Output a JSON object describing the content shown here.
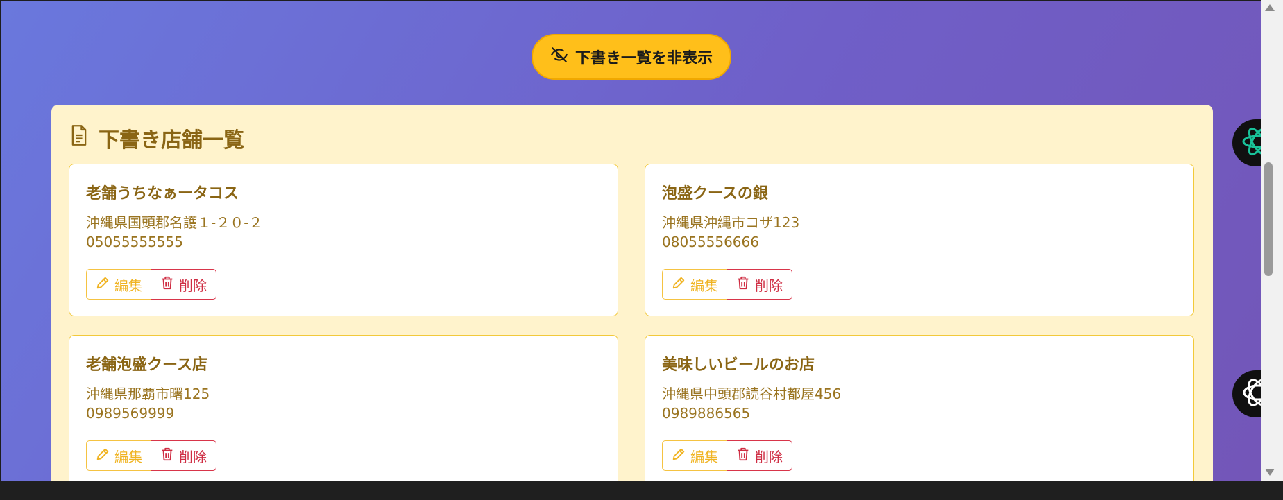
{
  "toggle_button": {
    "label": "下書き一覧を非表示",
    "icon": "eye-slash-icon"
  },
  "panel": {
    "title": "下書き店舗一覧",
    "icon": "document-icon",
    "cards": [
      {
        "name": "老舗うちなぁータコス",
        "address": "沖縄県国頭郡名護１-２０-２",
        "phone": "05055555555",
        "edit_label": "編集",
        "delete_label": "削除"
      },
      {
        "name": "泡盛クースの銀",
        "address": "沖縄県沖縄市コザ123",
        "phone": "08055556666",
        "edit_label": "編集",
        "delete_label": "削除"
      },
      {
        "name": "老舗泡盛クース店",
        "address": "沖縄県那覇市曙125",
        "phone": "0989569999",
        "edit_label": "編集",
        "delete_label": "削除"
      },
      {
        "name": "美味しいビールのお店",
        "address": "沖縄県中頭郡読谷村都屋456",
        "phone": "0989886565",
        "edit_label": "編集",
        "delete_label": "削除"
      }
    ]
  },
  "colors": {
    "accent": "#ffbf1a",
    "panel_bg": "#fff3cc",
    "title_text": "#8a6514",
    "edit": "#f0b321",
    "delete": "#cf2d43"
  }
}
